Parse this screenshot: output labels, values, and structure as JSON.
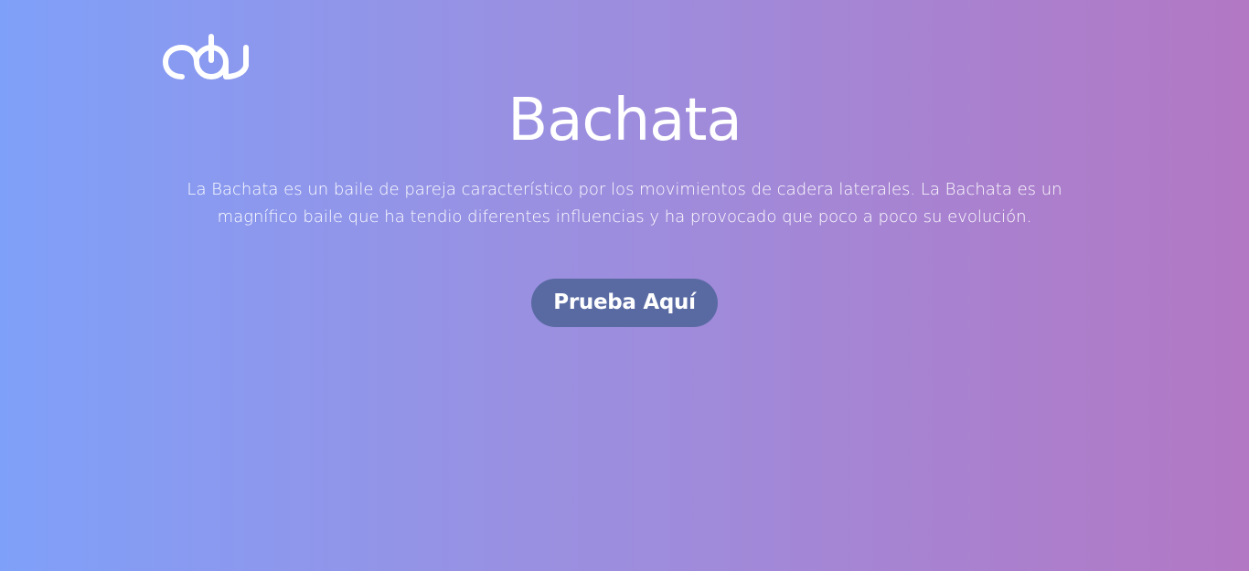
{
  "brand": {
    "logo_icon": "oda-logo-icon",
    "logo_text": "oda"
  },
  "hero": {
    "title": "Bachata",
    "description": "La Bachata es un baile de pareja característico por los movimientos de cadera laterales. La Bachata es un magnífico baile que ha tendio diferentes influencias y ha provocado que poco a poco su evolución.",
    "cta_label": "Prueba Aquí"
  },
  "colors": {
    "gradient_start": "#7fa0f9",
    "gradient_mid": "#9b8fe0",
    "gradient_end": "#b278c4",
    "cta_background": "#596aa3",
    "text": "#ffffff"
  }
}
